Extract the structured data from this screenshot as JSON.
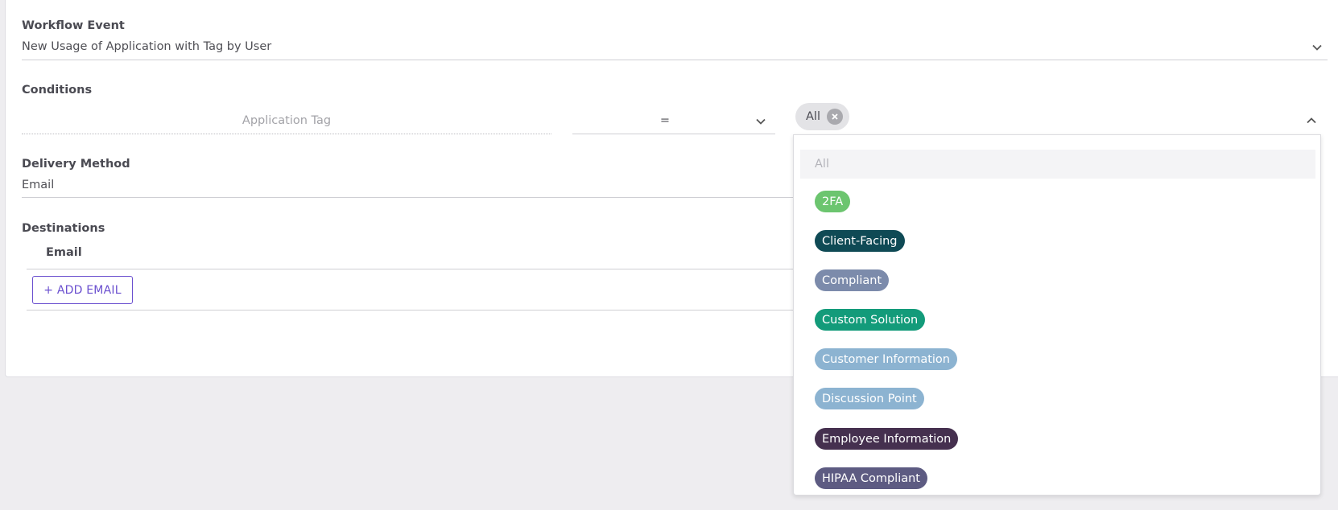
{
  "workflow_event": {
    "label": "Workflow Event",
    "value": "New Usage of Application with Tag by User"
  },
  "conditions": {
    "label": "Conditions",
    "field_placeholder": "Application Tag",
    "operator": "=",
    "selected_chip": "All"
  },
  "delivery": {
    "label": "Delivery Method",
    "value": "Email"
  },
  "destinations": {
    "label": "Destinations",
    "column_header": "Email",
    "add_button": "+ ADD EMAIL"
  },
  "dropdown": {
    "first_option": "All",
    "options": [
      {
        "label": "2FA",
        "color": "#6cc56f"
      },
      {
        "label": "Client-Facing",
        "color": "#0f4a55"
      },
      {
        "label": "Compliant",
        "color": "#7c8bab"
      },
      {
        "label": "Custom Solution",
        "color": "#139b7a"
      },
      {
        "label": "Customer Information",
        "color": "#8cb3d1"
      },
      {
        "label": "Discussion Point",
        "color": "#8cb3d1"
      },
      {
        "label": "Employee Information",
        "color": "#45304f"
      },
      {
        "label": "HIPAA Compliant",
        "color": "#5d5b82"
      }
    ]
  },
  "colors": {
    "accent": "#6a4fcf",
    "background": "#eeedf0"
  }
}
